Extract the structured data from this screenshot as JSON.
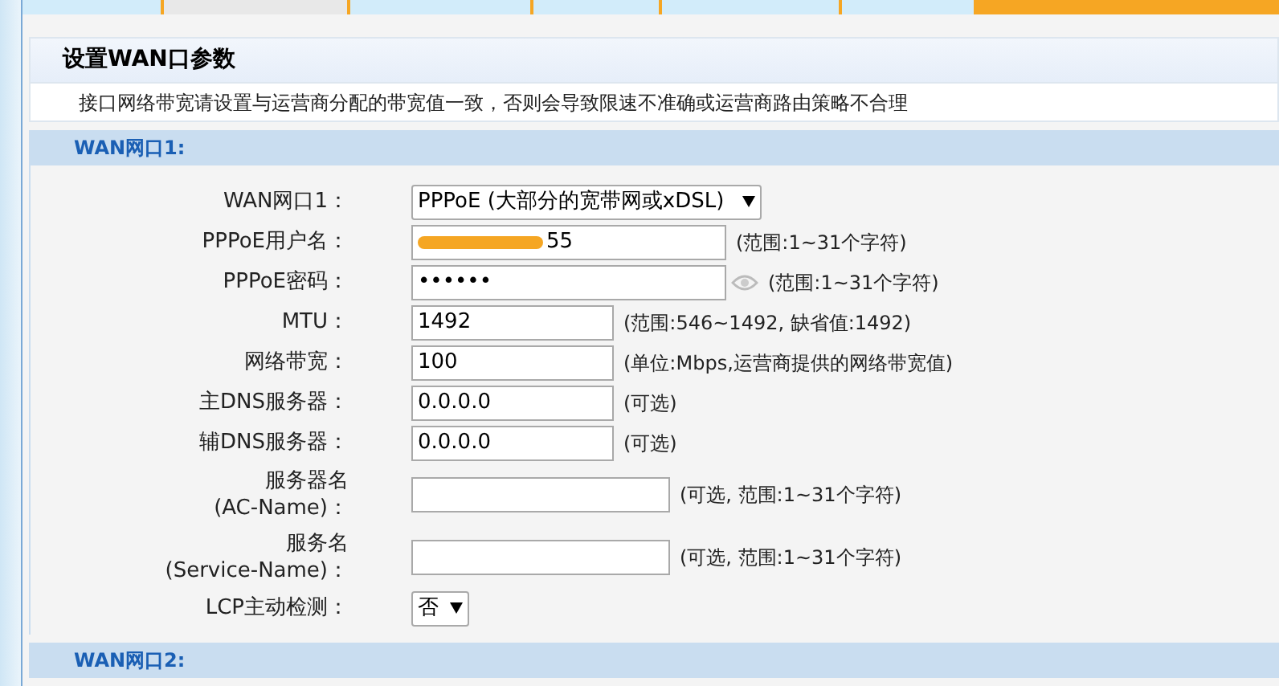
{
  "tabs": [
    {
      "selected": false
    },
    {
      "selected": true
    },
    {
      "selected": false
    },
    {
      "selected": false
    },
    {
      "selected": false
    },
    {
      "selected": false
    }
  ],
  "panel": {
    "title": "设置WAN口参数",
    "note": "接口网络带宽请设置与运营商分配的带宽值一致，否则会导致限速不准确或运营商路由策略不合理"
  },
  "sections": [
    {
      "title": "WAN网口1:",
      "fields": [
        {
          "kind": "select",
          "label": "WAN网口1：",
          "value": "PPPoE (大部分的宽带网或xDSL)"
        },
        {
          "kind": "redacted",
          "label": "PPPoE用户名：",
          "value": "55",
          "hint": "(范围:1~31个字符)"
        },
        {
          "kind": "password",
          "label": "PPPoE密码：",
          "value": "••••••",
          "hint": "(范围:1~31个字符)"
        },
        {
          "kind": "text",
          "label": "MTU：",
          "value": "1492",
          "hint": "(范围:546~1492, 缺省值:1492)"
        },
        {
          "kind": "text",
          "label": "网络带宽：",
          "value": "100",
          "hint": "(单位:Mbps,运营商提供的网络带宽值)"
        },
        {
          "kind": "text",
          "label": "主DNS服务器：",
          "value": "0.0.0.0",
          "hint": "(可选)"
        },
        {
          "kind": "text",
          "label": "辅DNS服务器：",
          "value": "0.0.0.0",
          "hint": "(可选)"
        },
        {
          "kind": "text",
          "label": "服务器名",
          "label2": "(AC-Name)：",
          "hint": "(可选, 范围:1~31个字符)"
        },
        {
          "kind": "text",
          "label": "服务名",
          "label2": "(Service-Name)：",
          "hint": "(可选, 范围:1~31个字符)"
        },
        {
          "kind": "select",
          "label": "LCP主动检测：",
          "value": "否"
        }
      ]
    },
    {
      "title": "WAN网口2:"
    }
  ]
}
